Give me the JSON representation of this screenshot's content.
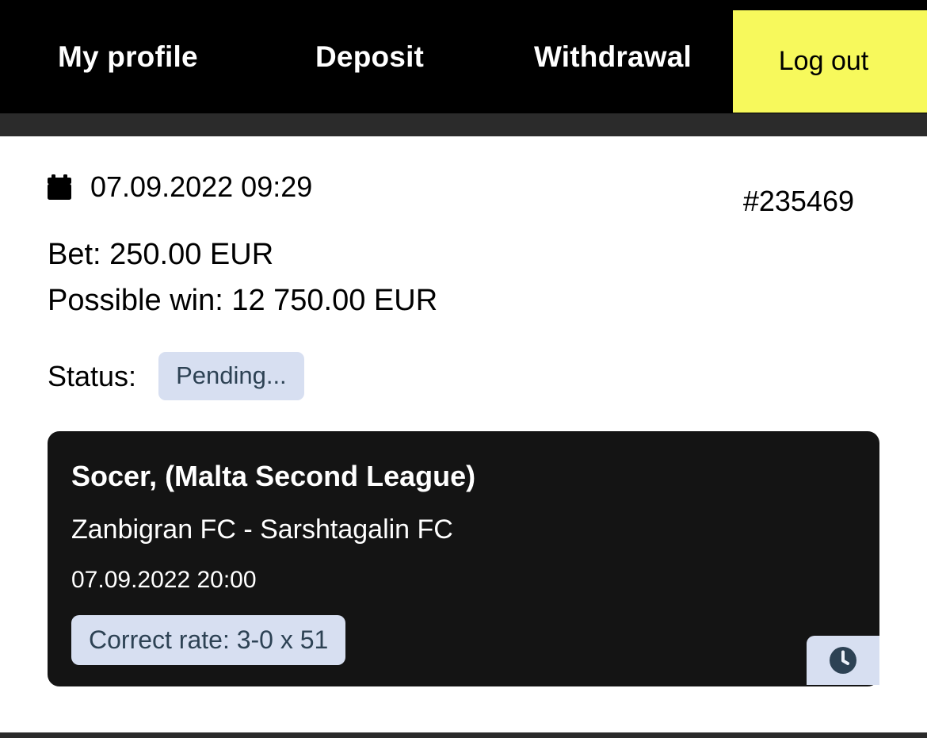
{
  "nav": {
    "items": [
      {
        "label": "My profile",
        "name": "nav-item-my-profile"
      },
      {
        "label": "Deposit",
        "name": "nav-item-deposit"
      },
      {
        "label": "Withdrawal",
        "name": "nav-item-withdrawal"
      }
    ],
    "logout_label": "Log out",
    "logout_bg_color": "#f7f95c",
    "bar_color": "#000000",
    "subbar_color": "#2b2b2b"
  },
  "bet": {
    "calendar_icon": "calendar-icon",
    "placed_at": "07.09.2022 09:29",
    "id": "#235469",
    "amount_line": "Bet: 250.00 EUR",
    "possible_win_line": "Possible win: 12 750.00 EUR",
    "status_label": "Status:",
    "status_value": "Pending...",
    "status_badge_bg": "#d7dff1",
    "status_badge_text_color": "#2d4254"
  },
  "event": {
    "league": "Socer, (Malta Second League)",
    "teams": "Zanbigran FC - Sarshtagalin FC",
    "datetime": "07.09.2022 20:00",
    "rate_badge": "Correct rate: 3-0   x 51",
    "card_bg": "#141414",
    "badge_bg": "#d7dff1",
    "badge_text_color": "#2d4254",
    "clock_icon": "clock-icon"
  },
  "footer": {
    "bar_color": "#2b2b2b"
  }
}
